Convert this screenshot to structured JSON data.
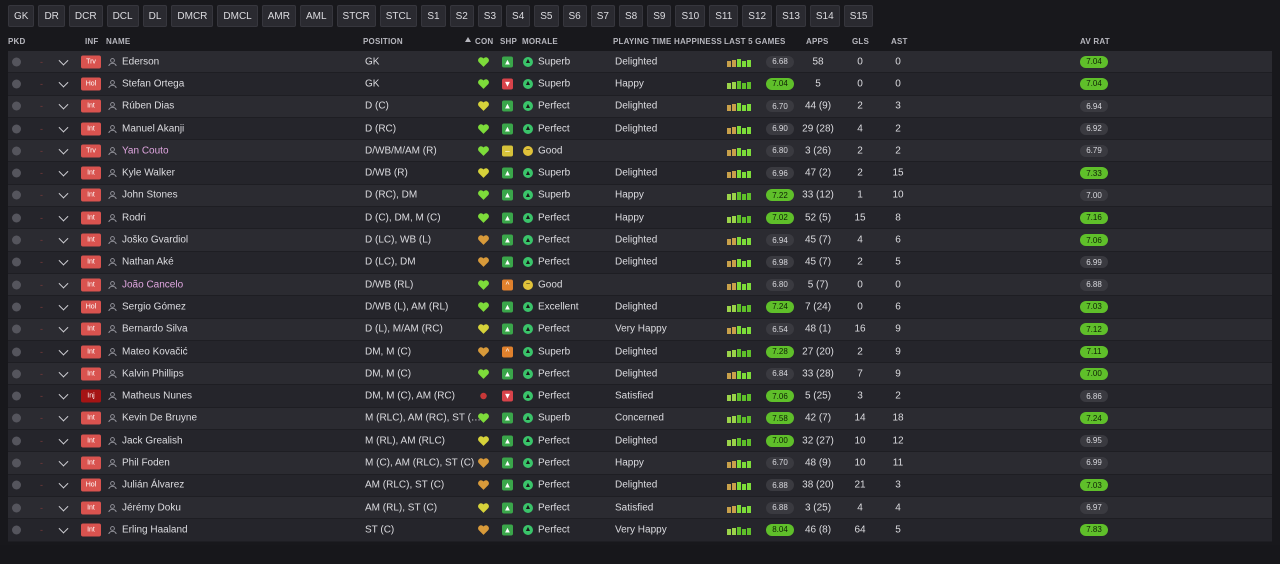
{
  "filters": [
    "GK",
    "DR",
    "DCR",
    "DCL",
    "DL",
    "DMCR",
    "DMCL",
    "AMR",
    "AML",
    "STCR",
    "STCL",
    "S1",
    "S2",
    "S3",
    "S4",
    "S5",
    "S6",
    "S7",
    "S8",
    "S9",
    "S10",
    "S11",
    "S12",
    "S13",
    "S14",
    "S15"
  ],
  "columns": {
    "pkd": "PKD",
    "inf": "INF",
    "name": "NAME",
    "position": "POSITION",
    "con": "CON",
    "shp": "SHP",
    "morale": "MORALE",
    "playing_time": "PLAYING TIME HAPPINESS",
    "last5": "LAST 5 GAMES",
    "apps": "APPS",
    "gls": "GLS",
    "ast": "AST",
    "avrat": "AV RAT"
  },
  "colors": {
    "heart_green": "#7ddc3a",
    "heart_yellow": "#d6d23a",
    "heart_orange": "#d89a3a",
    "shp_green": "#3aa64a",
    "shp_red": "#d8434a",
    "shp_yellow": "#d6c23a",
    "shp_orange": "#e0812d",
    "morale_green": "#3ac46a",
    "morale_yellow": "#e0c23a",
    "accent_green": "#5fbf2a"
  },
  "rows": [
    {
      "inf": "Trv",
      "name": "Ederson",
      "pos": "GK",
      "con": "green",
      "shp": "green",
      "mor": "green",
      "morale": "Superb",
      "pth": "Delighted",
      "l5": "6.68",
      "l5hi": false,
      "apps": "58",
      "gls": "0",
      "ast": "0",
      "av": "7.04",
      "avhi": true
    },
    {
      "inf": "Hol",
      "name": "Stefan Ortega",
      "pos": "GK",
      "con": "green",
      "shp": "red",
      "mor": "green",
      "morale": "Superb",
      "pth": "Happy",
      "l5": "7.04",
      "l5hi": true,
      "apps": "5",
      "gls": "0",
      "ast": "0",
      "av": "7.04",
      "avhi": true
    },
    {
      "inf": "Int",
      "name": "Rúben Dias",
      "pos": "D (C)",
      "con": "yellow",
      "shp": "green",
      "mor": "green",
      "morale": "Perfect",
      "pth": "Delighted",
      "l5": "6.70",
      "l5hi": false,
      "apps": "44 (9)",
      "gls": "2",
      "ast": "3",
      "av": "6.94",
      "avhi": false
    },
    {
      "inf": "Int",
      "name": "Manuel Akanji",
      "pos": "D (RC)",
      "con": "green",
      "shp": "green",
      "mor": "green",
      "morale": "Perfect",
      "pth": "Delighted",
      "l5": "6.90",
      "l5hi": false,
      "apps": "29 (28)",
      "gls": "4",
      "ast": "2",
      "av": "6.92",
      "avhi": false
    },
    {
      "inf": "Trv",
      "name": "Yan Couto",
      "pos": "D/WB/M/AM (R)",
      "con": "green",
      "shp": "yellow",
      "mor": "yellow",
      "morale": "Good",
      "pth": "",
      "l5": "6.80",
      "l5hi": false,
      "apps": "3 (26)",
      "gls": "2",
      "ast": "2",
      "av": "6.79",
      "avhi": false,
      "pink": true
    },
    {
      "inf": "Int",
      "name": "Kyle Walker",
      "pos": "D/WB (R)",
      "con": "yellow",
      "shp": "green",
      "mor": "green",
      "morale": "Superb",
      "pth": "Delighted",
      "l5": "6.96",
      "l5hi": false,
      "apps": "47 (2)",
      "gls": "2",
      "ast": "15",
      "av": "7.33",
      "avhi": true
    },
    {
      "inf": "Int",
      "name": "John Stones",
      "pos": "D (RC), DM",
      "con": "green",
      "shp": "green",
      "mor": "green",
      "morale": "Superb",
      "pth": "Happy",
      "l5": "7.22",
      "l5hi": true,
      "apps": "33 (12)",
      "gls": "1",
      "ast": "10",
      "av": "7.00",
      "avhi": false
    },
    {
      "inf": "Int",
      "name": "Rodri",
      "pos": "D (C), DM, M (C)",
      "con": "green",
      "shp": "green",
      "mor": "green",
      "morale": "Perfect",
      "pth": "Happy",
      "l5": "7.02",
      "l5hi": true,
      "apps": "52 (5)",
      "gls": "15",
      "ast": "8",
      "av": "7.16",
      "avhi": true
    },
    {
      "inf": "Int",
      "name": "Joško Gvardiol",
      "pos": "D (LC), WB (L)",
      "con": "orange",
      "shp": "green",
      "mor": "green",
      "morale": "Perfect",
      "pth": "Delighted",
      "l5": "6.94",
      "l5hi": false,
      "apps": "45 (7)",
      "gls": "4",
      "ast": "6",
      "av": "7.06",
      "avhi": true
    },
    {
      "inf": "Int",
      "name": "Nathan Aké",
      "pos": "D (LC), DM",
      "con": "orange",
      "shp": "green",
      "mor": "green",
      "morale": "Perfect",
      "pth": "Delighted",
      "l5": "6.98",
      "l5hi": false,
      "apps": "45 (7)",
      "gls": "2",
      "ast": "5",
      "av": "6.99",
      "avhi": false
    },
    {
      "inf": "Int",
      "name": "João Cancelo",
      "pos": "D/WB (RL)",
      "con": "green",
      "shp": "orange",
      "mor": "yellow",
      "morale": "Good",
      "pth": "",
      "l5": "6.80",
      "l5hi": false,
      "apps": "5 (7)",
      "gls": "0",
      "ast": "0",
      "av": "6.88",
      "avhi": false,
      "pink": true
    },
    {
      "inf": "Hol",
      "name": "Sergio Gómez",
      "pos": "D/WB (L), AM (RL)",
      "con": "green",
      "shp": "green",
      "mor": "green",
      "morale": "Excellent",
      "pth": "Delighted",
      "l5": "7.24",
      "l5hi": true,
      "apps": "7 (24)",
      "gls": "0",
      "ast": "6",
      "av": "7.03",
      "avhi": true
    },
    {
      "inf": "Int",
      "name": "Bernardo Silva",
      "pos": "D (L), M/AM (RC)",
      "con": "yellow",
      "shp": "green",
      "mor": "green",
      "morale": "Perfect",
      "pth": "Very Happy",
      "l5": "6.54",
      "l5hi": false,
      "apps": "48 (1)",
      "gls": "16",
      "ast": "9",
      "av": "7.12",
      "avhi": true
    },
    {
      "inf": "Int",
      "name": "Mateo Kovačić",
      "pos": "DM, M (C)",
      "con": "orange",
      "shp": "orange",
      "mor": "green",
      "morale": "Superb",
      "pth": "Delighted",
      "l5": "7.28",
      "l5hi": true,
      "apps": "27 (20)",
      "gls": "2",
      "ast": "9",
      "av": "7.11",
      "avhi": true
    },
    {
      "inf": "Int",
      "name": "Kalvin Phillips",
      "pos": "DM, M (C)",
      "con": "green",
      "shp": "green",
      "mor": "green",
      "morale": "Perfect",
      "pth": "Delighted",
      "l5": "6.84",
      "l5hi": false,
      "apps": "33 (28)",
      "gls": "7",
      "ast": "9",
      "av": "7.00",
      "avhi": true
    },
    {
      "inf": "Inj",
      "name": "Matheus Nunes",
      "pos": "DM, M (C), AM (RC)",
      "con": "red",
      "shp": "red",
      "mor": "green",
      "morale": "Perfect",
      "pth": "Satisfied",
      "l5": "7.06",
      "l5hi": true,
      "apps": "5 (25)",
      "gls": "3",
      "ast": "2",
      "av": "6.86",
      "avhi": false
    },
    {
      "inf": "Int",
      "name": "Kevin De Bruyne",
      "pos": "M (RLC), AM (RC), ST (…",
      "con": "green",
      "shp": "green",
      "mor": "green",
      "morale": "Superb",
      "pth": "Concerned",
      "l5": "7.58",
      "l5hi": true,
      "apps": "42 (7)",
      "gls": "14",
      "ast": "18",
      "av": "7.24",
      "avhi": true
    },
    {
      "inf": "Int",
      "name": "Jack Grealish",
      "pos": "M (RL), AM (RLC)",
      "con": "yellow",
      "shp": "green",
      "mor": "green",
      "morale": "Perfect",
      "pth": "Delighted",
      "l5": "7.00",
      "l5hi": true,
      "apps": "32 (27)",
      "gls": "10",
      "ast": "12",
      "av": "6.95",
      "avhi": false
    },
    {
      "inf": "Int",
      "name": "Phil Foden",
      "pos": "M (C), AM (RLC), ST (C)",
      "con": "orange",
      "shp": "green",
      "mor": "green",
      "morale": "Perfect",
      "pth": "Happy",
      "l5": "6.70",
      "l5hi": false,
      "apps": "48 (9)",
      "gls": "10",
      "ast": "11",
      "av": "6.99",
      "avhi": false
    },
    {
      "inf": "Hol",
      "name": "Julián Álvarez",
      "pos": "AM (RLC), ST (C)",
      "con": "orange",
      "shp": "green",
      "mor": "green",
      "morale": "Perfect",
      "pth": "Delighted",
      "l5": "6.88",
      "l5hi": false,
      "apps": "38 (20)",
      "gls": "21",
      "ast": "3",
      "av": "7.03",
      "avhi": true
    },
    {
      "inf": "Int",
      "name": "Jérémy Doku",
      "pos": "AM (RL), ST (C)",
      "con": "yellow",
      "shp": "green",
      "mor": "green",
      "morale": "Perfect",
      "pth": "Satisfied",
      "l5": "6.88",
      "l5hi": false,
      "apps": "3 (25)",
      "gls": "4",
      "ast": "4",
      "av": "6.97",
      "avhi": false
    },
    {
      "inf": "Int",
      "name": "Erling Haaland",
      "pos": "ST (C)",
      "con": "orange",
      "shp": "green",
      "mor": "green",
      "morale": "Perfect",
      "pth": "Very Happy",
      "l5": "8.04",
      "l5hi": true,
      "apps": "46 (8)",
      "gls": "64",
      "ast": "5",
      "av": "7.83",
      "avhi": true
    }
  ]
}
